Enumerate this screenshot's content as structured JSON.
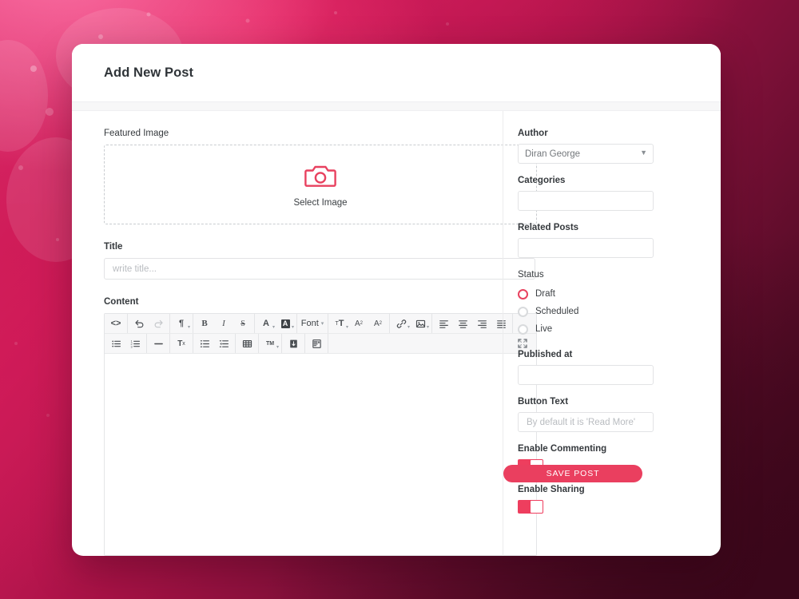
{
  "window": {
    "card_title": "Add New Post"
  },
  "main": {
    "featured_image": {
      "label": "Featured Image",
      "icon": "camera-icon",
      "select_text": "Select Image"
    },
    "title": {
      "label": "Title",
      "value": "",
      "placeholder": "write title..."
    },
    "content": {
      "label": "Content",
      "value": "",
      "toolbar_row1": [
        {
          "name": "code-view-icon",
          "glyph": "<>",
          "type": "text",
          "caret": false,
          "disabled": false
        },
        {
          "name": "undo-icon",
          "glyph": "undo",
          "type": "svg",
          "caret": false,
          "disabled": false
        },
        {
          "name": "redo-icon",
          "glyph": "redo",
          "type": "svg",
          "caret": false,
          "disabled": true
        },
        {
          "name": "paragraph-format-icon",
          "glyph": "¶",
          "type": "text",
          "caret": true,
          "disabled": false
        },
        {
          "name": "bold-icon",
          "glyph": "B",
          "type": "bold",
          "caret": false,
          "disabled": false
        },
        {
          "name": "italic-icon",
          "glyph": "I",
          "type": "italic",
          "caret": false,
          "disabled": false
        },
        {
          "name": "strikethrough-icon",
          "glyph": "S",
          "type": "strike",
          "caret": false,
          "disabled": false
        },
        {
          "name": "text-color-icon",
          "glyph": "A",
          "type": "text",
          "caret": true,
          "disabled": false
        },
        {
          "name": "highlight-color-icon",
          "glyph": "A",
          "type": "invert",
          "caret": true,
          "disabled": false
        },
        {
          "name": "font-family-dropdown",
          "glyph": "Font",
          "type": "font",
          "caret": true,
          "disabled": false
        },
        {
          "name": "font-size-icon",
          "glyph": "T",
          "type": "fontsize",
          "caret": true,
          "disabled": false
        },
        {
          "name": "superscript-icon",
          "glyph": "A",
          "type": "sup",
          "caret": false,
          "disabled": false
        },
        {
          "name": "subscript-icon",
          "glyph": "A",
          "type": "sub",
          "caret": false,
          "disabled": false
        },
        {
          "name": "insert-link-icon",
          "glyph": "link",
          "type": "svg",
          "caret": true,
          "disabled": false
        },
        {
          "name": "insert-image-icon",
          "glyph": "image",
          "type": "svg",
          "caret": true,
          "disabled": false
        },
        {
          "name": "align-left-icon",
          "glyph": "align-left",
          "type": "svg",
          "caret": false,
          "disabled": false
        },
        {
          "name": "align-center-icon",
          "glyph": "align-center",
          "type": "svg",
          "caret": false,
          "disabled": false
        },
        {
          "name": "align-right-icon",
          "glyph": "align-right",
          "type": "svg",
          "caret": false,
          "disabled": false
        },
        {
          "name": "align-justify-icon",
          "glyph": "align-justify",
          "type": "svg",
          "caret": false,
          "disabled": false
        }
      ],
      "toolbar_row2": [
        {
          "name": "unordered-list-icon",
          "glyph": "ul",
          "type": "svg",
          "caret": false,
          "disabled": false
        },
        {
          "name": "ordered-list-icon",
          "glyph": "ol",
          "type": "svg",
          "caret": false,
          "disabled": false
        },
        {
          "name": "horizontal-rule-icon",
          "glyph": "hr",
          "type": "svg",
          "caret": false,
          "disabled": false
        },
        {
          "name": "clear-formatting-icon",
          "glyph": "Tx",
          "type": "clear",
          "caret": false,
          "disabled": false
        },
        {
          "name": "increase-indent-icon",
          "glyph": "indent",
          "type": "svg",
          "caret": false,
          "disabled": false
        },
        {
          "name": "decrease-indent-icon",
          "glyph": "outdent",
          "type": "svg",
          "caret": false,
          "disabled": false
        },
        {
          "name": "insert-table-icon",
          "glyph": "table",
          "type": "svg",
          "caret": false,
          "disabled": false
        },
        {
          "name": "special-character-icon",
          "glyph": "TM",
          "type": "tm",
          "caret": true,
          "disabled": false
        },
        {
          "name": "page-break-icon",
          "glyph": "pagebreak",
          "type": "svg",
          "caret": false,
          "disabled": false
        },
        {
          "name": "insert-template-icon",
          "glyph": "template",
          "type": "svg",
          "caret": false,
          "disabled": false
        }
      ],
      "expand_icon": "fullscreen-icon"
    }
  },
  "sidebar": {
    "author": {
      "label": "Author",
      "value": "Diran George",
      "options": [
        "Diran George"
      ]
    },
    "categories": {
      "label": "Categories",
      "value": "",
      "placeholder": ""
    },
    "related_posts": {
      "label": "Related Posts",
      "value": "",
      "placeholder": ""
    },
    "status": {
      "label": "Status",
      "options": [
        {
          "label": "Draft",
          "checked": true
        },
        {
          "label": "Scheduled",
          "checked": false
        },
        {
          "label": "Live",
          "checked": false
        }
      ]
    },
    "published_at": {
      "label": "Published at",
      "value": "",
      "placeholder": ""
    },
    "button_text": {
      "label": "Button Text",
      "value": "",
      "placeholder": "By default it is 'Read More'"
    },
    "enable_commenting": {
      "label": "Enable Commenting",
      "on": true
    },
    "enable_sharing": {
      "label": "Enable Sharing",
      "on": true
    },
    "save_button": "SAVE POST"
  },
  "colors": {
    "accent": "#ea3f5f",
    "accent_dark": "#d31d5c",
    "background_light": "#e33a78",
    "background_dark": "#350617",
    "card": "#ffffff",
    "text": "#2f3438"
  }
}
